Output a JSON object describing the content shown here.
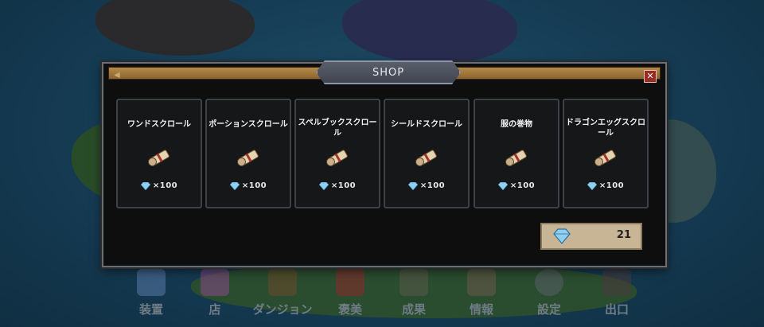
{
  "shop": {
    "title": "SHOP",
    "close_label": "✕",
    "back_label": "◀",
    "items": [
      {
        "name": "ワンドスクロール",
        "currency_icon": "diamond-icon",
        "price": "×100"
      },
      {
        "name": "ポーションスクロール",
        "currency_icon": "diamond-icon",
        "price": "×100"
      },
      {
        "name": "スペルブックスクロール",
        "currency_icon": "diamond-icon",
        "price": "×100"
      },
      {
        "name": "シールドスクロール",
        "currency_icon": "diamond-icon",
        "price": "×100"
      },
      {
        "name": "服の巻物",
        "currency_icon": "diamond-icon",
        "price": "×100"
      },
      {
        "name": "ドラゴンエッグスクロール",
        "currency_icon": "diamond-icon",
        "price": "×100"
      }
    ],
    "balance": "21"
  },
  "bottom_nav": [
    {
      "label": "装置",
      "icon": "armor-icon"
    },
    {
      "label": "店",
      "icon": "chest-icon"
    },
    {
      "label": "ダンジョン",
      "icon": "dungeon-icon"
    },
    {
      "label": "褒美",
      "icon": "gift-icon"
    },
    {
      "label": "成果",
      "icon": "achievement-icon"
    },
    {
      "label": "情報",
      "icon": "magnifier-icon"
    },
    {
      "label": "設定",
      "icon": "gear-icon"
    },
    {
      "label": "出口",
      "icon": "exit-icon"
    }
  ],
  "colors": {
    "accent_gold": "#b48a4a",
    "gem_blue": "#8fd0f0",
    "close_red": "#9a2a22",
    "balance_bg": "#c7b596"
  }
}
